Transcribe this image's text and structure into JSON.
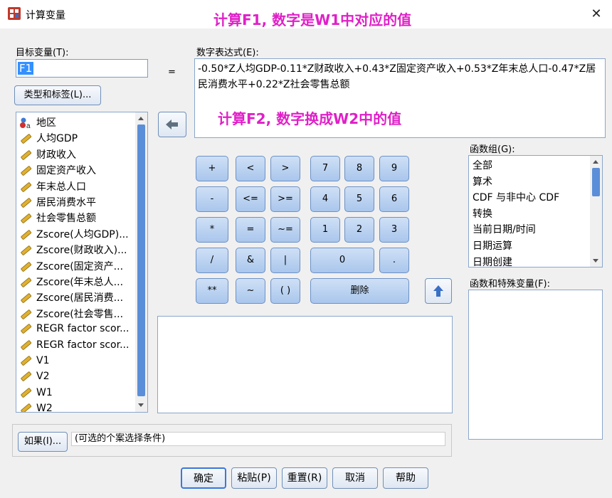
{
  "window": {
    "title": "计算变量"
  },
  "annotations": {
    "f1": "计算F1, 数字是W1中对应的值",
    "f2": "计算F2, 数字换成W2中的值"
  },
  "target": {
    "label": "目标变量(T):",
    "value": "F1",
    "type_label_button": "类型和标签(L)..."
  },
  "equals": "=",
  "expression": {
    "label": "数字表达式(E):",
    "value": "-0.50*Z人均GDP-0.11*Z财政收入+0.43*Z固定资产收入+0.53*Z年末总人口-0.47*Z居民消费水平+0.22*Z社会零售总额"
  },
  "variables": [
    {
      "label": "地区",
      "icon": "nominal-icon"
    },
    {
      "label": "人均GDP",
      "icon": "scale-icon"
    },
    {
      "label": "财政收入",
      "icon": "scale-icon"
    },
    {
      "label": "固定资产收入",
      "icon": "scale-icon"
    },
    {
      "label": "年末总人口",
      "icon": "scale-icon"
    },
    {
      "label": "居民消费水平",
      "icon": "scale-icon"
    },
    {
      "label": "社会零售总额",
      "icon": "scale-icon"
    },
    {
      "label": "Zscore(人均GDP)...",
      "icon": "scale-icon"
    },
    {
      "label": "Zscore(财政收入)...",
      "icon": "scale-icon"
    },
    {
      "label": "Zscore(固定资产...",
      "icon": "scale-icon"
    },
    {
      "label": "Zscore(年末总人...",
      "icon": "scale-icon"
    },
    {
      "label": "Zscore(居民消费...",
      "icon": "scale-icon"
    },
    {
      "label": "Zscore(社会零售...",
      "icon": "scale-icon"
    },
    {
      "label": "REGR factor scor...",
      "icon": "scale-icon"
    },
    {
      "label": "REGR factor scor...",
      "icon": "scale-icon"
    },
    {
      "label": "V1",
      "icon": "scale-icon"
    },
    {
      "label": "V2",
      "icon": "scale-icon"
    },
    {
      "label": "W1",
      "icon": "scale-icon"
    },
    {
      "label": "W2",
      "icon": "scale-icon"
    }
  ],
  "keypad": {
    "k_plus": "+",
    "k_lt": "<",
    "k_gt": ">",
    "k_7": "7",
    "k_8": "8",
    "k_9": "9",
    "k_minus": "-",
    "k_le": "<=",
    "k_ge": ">=",
    "k_4": "4",
    "k_5": "5",
    "k_6": "6",
    "k_mul": "*",
    "k_eq": "=",
    "k_ne": "~=",
    "k_1": "1",
    "k_2": "2",
    "k_3": "3",
    "k_div": "/",
    "k_and": "&",
    "k_or": "|",
    "k_0": "0",
    "k_dot": ".",
    "k_pow": "**",
    "k_not": "~",
    "k_paren": "( )",
    "k_delete": "删除"
  },
  "function_group": {
    "label": "函数组(G):",
    "items": [
      "全部",
      "算术",
      "CDF 与非中心 CDF",
      "转换",
      "当前日期/时间",
      "日期运算",
      "日期创建"
    ]
  },
  "function_vars": {
    "label": "函数和特殊变量(F):"
  },
  "condition": {
    "button": "如果(I)...",
    "text": "(可选的个案选择条件)"
  },
  "buttons": {
    "ok": "确定",
    "paste": "粘贴(P)",
    "reset": "重置(R)",
    "cancel": "取消",
    "help": "帮助"
  }
}
